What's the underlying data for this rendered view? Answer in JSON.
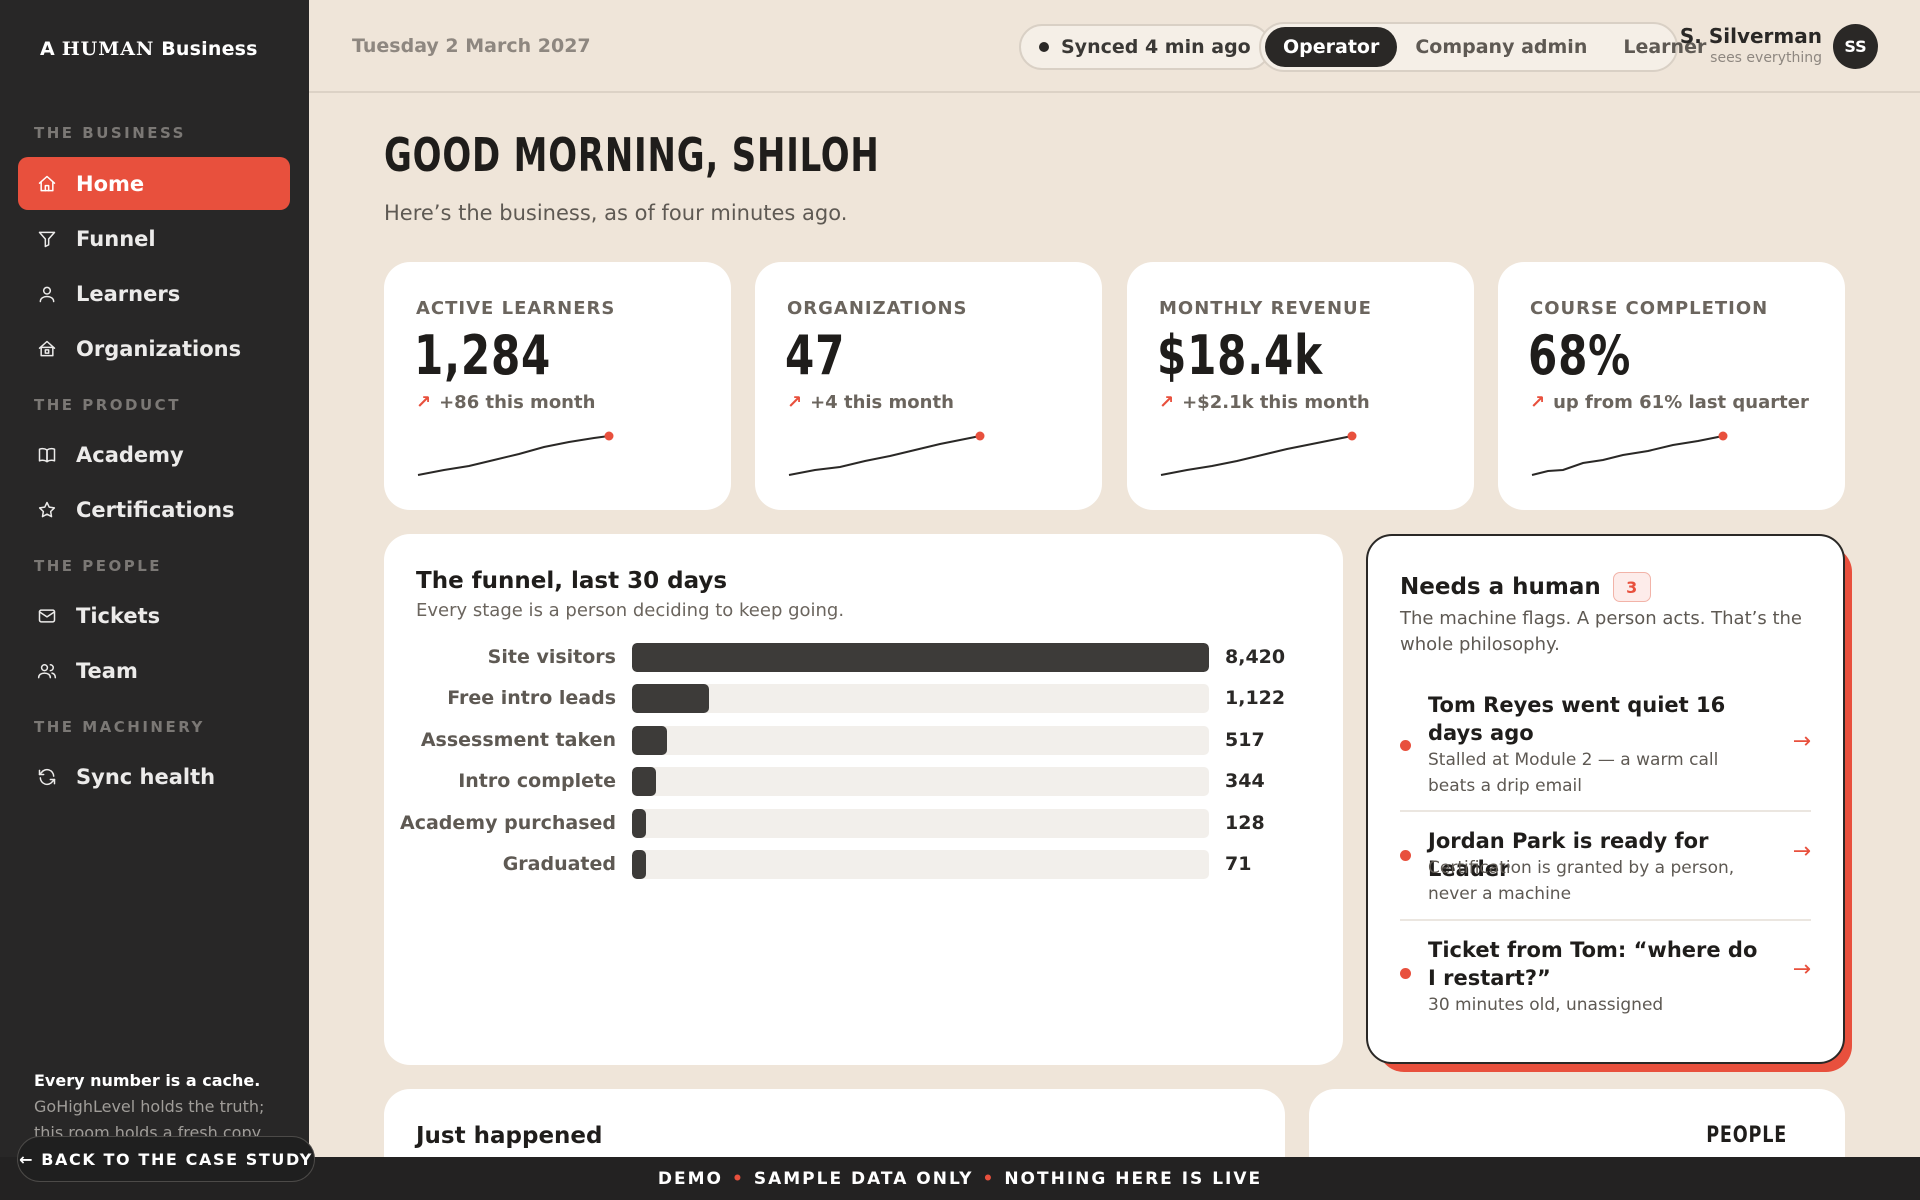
{
  "brand": {
    "prefix": "A",
    "handwritten": "HUMAN",
    "suffix": "Business"
  },
  "sidebar": {
    "sections": [
      {
        "title": "THE BUSINESS"
      },
      {
        "title": "THE PRODUCT"
      },
      {
        "title": "THE PEOPLE"
      },
      {
        "title": "THE MACHINERY"
      }
    ],
    "items": [
      {
        "label": "Home",
        "icon": "home-icon",
        "active": true
      },
      {
        "label": "Funnel",
        "icon": "filter-icon"
      },
      {
        "label": "Learners",
        "icon": "user-icon"
      },
      {
        "label": "Organizations",
        "icon": "building-icon"
      },
      {
        "label": "Academy",
        "icon": "book-icon"
      },
      {
        "label": "Certifications",
        "icon": "star-icon"
      },
      {
        "label": "Tickets",
        "icon": "mail-icon"
      },
      {
        "label": "Team",
        "icon": "users-icon"
      },
      {
        "label": "Sync health",
        "icon": "refresh-icon"
      }
    ],
    "note_title": "Every number is a cache.",
    "note_body": "GoHighLevel holds the truth; this room holds a fresh copy and",
    "back_label": "← BACK TO THE CASE STUDY"
  },
  "topbar": {
    "date": "Tuesday 2 March 2027",
    "sync_status": "Synced 4 min ago",
    "roles": [
      "Operator",
      "Company admin",
      "Learner"
    ],
    "active_role": "Operator",
    "user_name": "S. Silverman",
    "user_sub": "sees everything",
    "user_initials": "SS"
  },
  "greeting": "GOOD MORNING, SHILOH",
  "subgreeting": "Here’s the business, as of four minutes ago.",
  "kpis": [
    {
      "label": "ACTIVE LEARNERS",
      "value": "1,284",
      "delta": "+86 this month"
    },
    {
      "label": "ORGANIZATIONS",
      "value": "47",
      "delta": "+4 this month"
    },
    {
      "label": "MONTHLY REVENUE",
      "value": "$18.4k",
      "delta": "+$2.1k this month"
    },
    {
      "label": "COURSE COMPLETION",
      "value": "68%",
      "delta": "up from 61% last quarter"
    }
  ],
  "funnel": {
    "title": "The funnel, last 30 days",
    "subtitle": "Every stage is a person deciding to keep going.",
    "stages": [
      {
        "label": "Site visitors",
        "value": 8420,
        "display": "8,420"
      },
      {
        "label": "Free intro leads",
        "value": 1122,
        "display": "1,122"
      },
      {
        "label": "Assessment taken",
        "value": 517,
        "display": "517"
      },
      {
        "label": "Intro complete",
        "value": 344,
        "display": "344"
      },
      {
        "label": "Academy purchased",
        "value": 128,
        "display": "128"
      },
      {
        "label": "Graduated",
        "value": 71,
        "display": "71"
      }
    ]
  },
  "needs_human": {
    "title": "Needs a human",
    "count": "3",
    "subtitle": "The machine flags. A person acts. That’s the whole philosophy.",
    "flags": [
      {
        "title": "Tom Reyes went quiet 16 days ago",
        "desc": "Stalled at Module 2 — a warm call beats a drip email"
      },
      {
        "title": "Jordan Park is ready for Leader",
        "desc": "Certification is granted by a person, never a machine"
      },
      {
        "title": "Ticket from Tom: “where do I restart?”",
        "desc": "30 minutes old, unassigned"
      }
    ],
    "arrow": "→"
  },
  "bottom": {
    "left_title": "Just happened",
    "right_tag": "PEOPLE"
  },
  "demo_bar": [
    "DEMO",
    "SAMPLE DATA ONLY",
    "NOTHING HERE IS LIVE"
  ],
  "accent": "#e8503d"
}
